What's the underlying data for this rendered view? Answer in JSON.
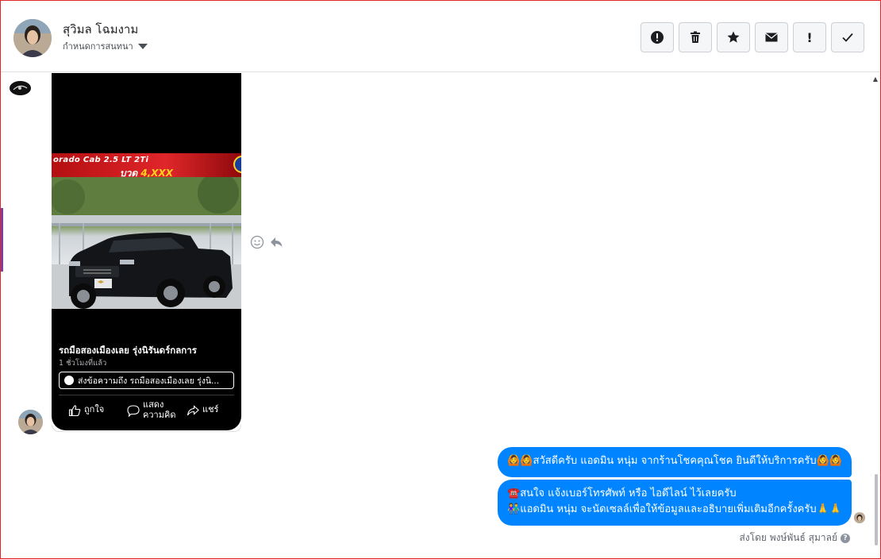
{
  "header": {
    "contact_name": "สุวิมล โฉมงาม",
    "subtitle": "กำหนดการสนทนา",
    "toolbar": [
      {
        "name": "spam-report-button",
        "icon": "exclamation-circle-icon",
        "glyph": ""
      },
      {
        "name": "delete-button",
        "icon": "trash-icon",
        "glyph": ""
      },
      {
        "name": "star-button",
        "icon": "star-icon",
        "glyph": ""
      },
      {
        "name": "mark-unread-button",
        "icon": "envelope-icon",
        "glyph": ""
      },
      {
        "name": "follow-up-button",
        "icon": "exclamation-icon",
        "glyph": "!"
      },
      {
        "name": "done-button",
        "icon": "checkmark-icon",
        "glyph": ""
      }
    ]
  },
  "post": {
    "banner_line1": "orado Cab 2.5 LT 2Ti",
    "banner_line2_prefix": "บวด ",
    "banner_line2_highlight": "4,XXX",
    "title": "รถมือสองเมืองเลย รุ่งนิรันดร์กลการ",
    "time": "1 ชั่วโมงที่แล้ว",
    "message_button": "ส่งข้อความถึง รถมือสองเมืองเลย รุ่งนิ...",
    "actions": {
      "like": "ถูกใจ",
      "comment_line1": "แสดง",
      "comment_line2": "ความคิด",
      "share": "แชร์"
    }
  },
  "messages": [
    {
      "line1": "🙆🙆สวัสดีครับ แอดมิน หนุ่ม จากร้านโชคคุณโชค ยินดีให้บริการครับ🙆🙆"
    },
    {
      "line1": "☎️สนใจ แจ้งเบอร์โทรศัพท์ หรือ ไอดีไลน์  ไว้เลยครับ",
      "line2": "👫แอดมิน หนุ่ม จะนัดเซลล์เพื่อให้ข้อมูลและอธิบายเพิ่มเติมอีกครั้งครับ🙏🙏"
    }
  ],
  "footer": {
    "sent_by": "ส่งโดย พงษ์พันธ์ สุมาลย์",
    "help_glyph": "?"
  },
  "colors": {
    "bubble": "#0084ff",
    "frame_border": "#e2262b"
  }
}
